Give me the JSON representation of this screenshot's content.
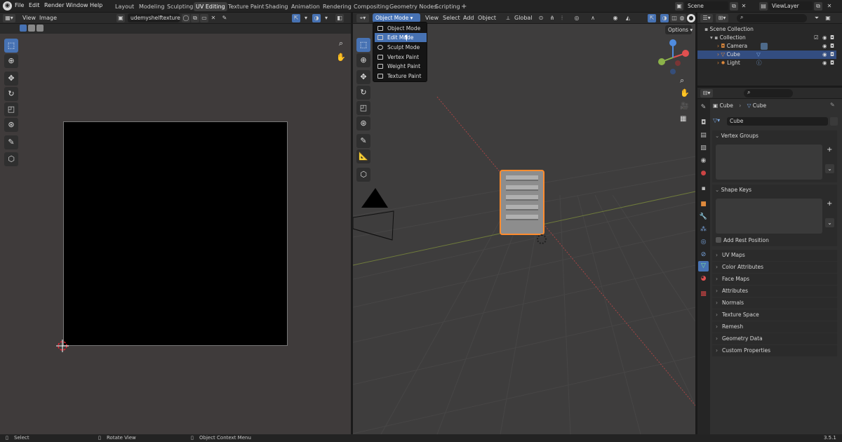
{
  "topbar": {
    "menus": [
      "File",
      "Edit",
      "Render",
      "Window",
      "Help"
    ],
    "workspaces": [
      "Layout",
      "Modeling",
      "Sculpting",
      "UV Editing",
      "Texture Paint",
      "Shading",
      "Animation",
      "Rendering",
      "Compositing",
      "Geometry Nodes",
      "Scripting"
    ],
    "active_workspace": "UV Editing",
    "add_tab": "+",
    "scene": "Scene",
    "view_layer": "ViewLayer"
  },
  "uv_editor": {
    "menus": [
      "View",
      "Image"
    ],
    "image_name": "udemyshelftexture"
  },
  "viewport": {
    "mode": "Object Mode",
    "menus": [
      "View",
      "Select",
      "Add",
      "Object"
    ],
    "orientation": "Global",
    "options": "Options",
    "mode_menu": [
      "Object Mode",
      "Edit Mode",
      "Sculpt Mode",
      "Vertex Paint",
      "Weight Paint",
      "Texture Paint"
    ],
    "mode_menu_highlighted": "Edit Mode"
  },
  "outliner": {
    "scene_collection": "Scene Collection",
    "collection": "Collection",
    "objects": [
      "Camera",
      "Cube",
      "Light"
    ],
    "selected": "Cube"
  },
  "properties": {
    "breadcrumb_object": "Cube",
    "breadcrumb_mesh": "Cube",
    "mesh_name": "Cube",
    "vertex_groups": "Vertex Groups",
    "shape_keys": "Shape Keys",
    "add_rest_position": "Add Rest Position",
    "panels": [
      "UV Maps",
      "Color Attributes",
      "Face Maps",
      "Attributes",
      "Normals",
      "Texture Space",
      "Remesh",
      "Geometry Data",
      "Custom Properties"
    ]
  },
  "status_bar": {
    "select": "Select",
    "rotate": "Rotate View",
    "context": "Object Context Menu",
    "version": "3.5.1"
  },
  "colors": {
    "accent": "#4772b3",
    "selection_orange": "#ff8c2e",
    "uv_bg": "#3f3b3b",
    "viewport_bg": "#3e3d3d"
  }
}
